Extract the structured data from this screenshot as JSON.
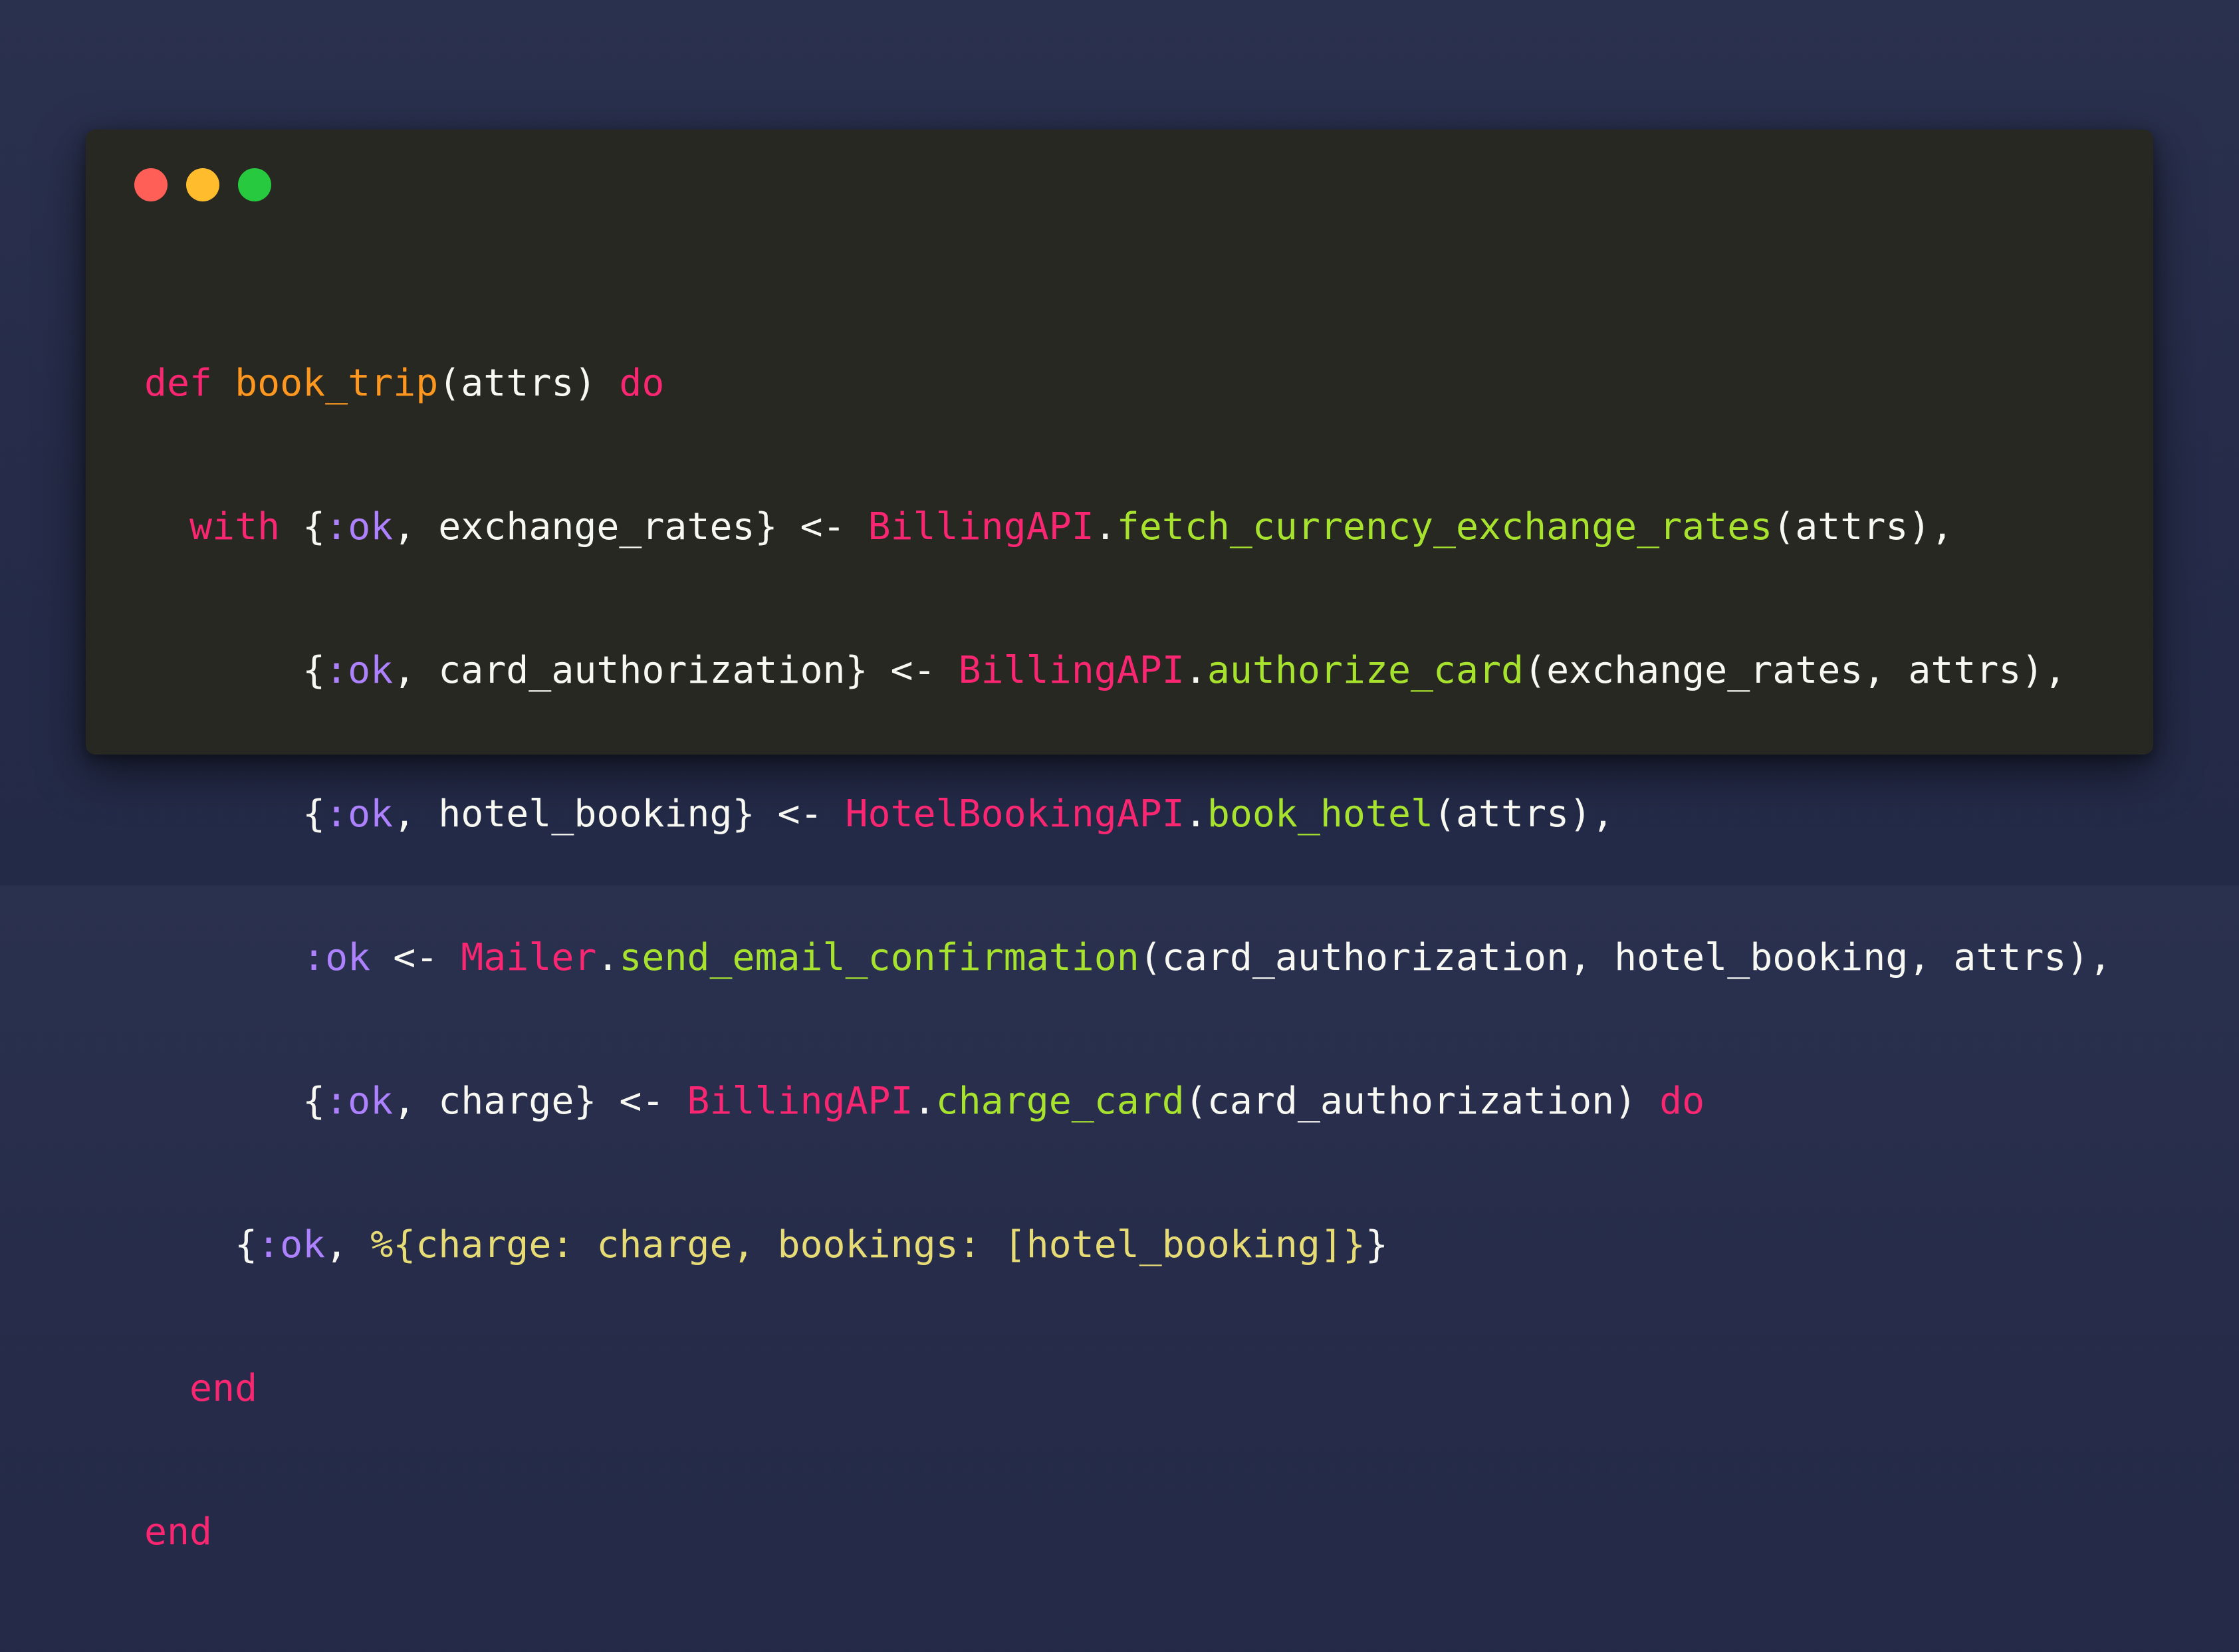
{
  "window": {
    "controls": [
      {
        "name": "close",
        "color": "#ff5f56"
      },
      {
        "name": "minimize",
        "color": "#ffbd2e"
      },
      {
        "name": "maximize",
        "color": "#27c93f"
      }
    ],
    "background_color": "#272822"
  },
  "colors": {
    "keyword": "#f92672",
    "function_name": "#fd971f",
    "atom": "#ae81ff",
    "module": "#f92672",
    "function_call": "#a6e22e",
    "map_literal": "#e6db74",
    "plain": "#f8f8f2",
    "page_background": "#262c4a"
  },
  "code": {
    "lines": [
      [
        {
          "type": "kw",
          "text": "def"
        },
        {
          "type": "plain",
          "text": " "
        },
        {
          "type": "fn",
          "text": "book_trip"
        },
        {
          "type": "plain",
          "text": "(attrs) "
        },
        {
          "type": "kw",
          "text": "do"
        }
      ],
      [
        {
          "type": "plain",
          "text": "  "
        },
        {
          "type": "kw",
          "text": "with"
        },
        {
          "type": "plain",
          "text": " {"
        },
        {
          "type": "atom",
          "text": ":ok"
        },
        {
          "type": "plain",
          "text": ", exchange_rates} <- "
        },
        {
          "type": "mod",
          "text": "BillingAPI"
        },
        {
          "type": "plain",
          "text": "."
        },
        {
          "type": "call",
          "text": "fetch_currency_exchange_rates"
        },
        {
          "type": "plain",
          "text": "(attrs),"
        }
      ],
      [
        {
          "type": "plain",
          "text": "       {"
        },
        {
          "type": "atom",
          "text": ":ok"
        },
        {
          "type": "plain",
          "text": ", card_authorization} <- "
        },
        {
          "type": "mod",
          "text": "BillingAPI"
        },
        {
          "type": "plain",
          "text": "."
        },
        {
          "type": "call",
          "text": "authorize_card"
        },
        {
          "type": "plain",
          "text": "(exchange_rates, attrs),"
        }
      ],
      [
        {
          "type": "plain",
          "text": "       {"
        },
        {
          "type": "atom",
          "text": ":ok"
        },
        {
          "type": "plain",
          "text": ", hotel_booking} <- "
        },
        {
          "type": "mod",
          "text": "HotelBookingAPI"
        },
        {
          "type": "plain",
          "text": "."
        },
        {
          "type": "call",
          "text": "book_hotel"
        },
        {
          "type": "plain",
          "text": "(attrs),"
        }
      ],
      [
        {
          "type": "plain",
          "text": "       "
        },
        {
          "type": "atom",
          "text": ":ok"
        },
        {
          "type": "plain",
          "text": " <- "
        },
        {
          "type": "mod",
          "text": "Mailer"
        },
        {
          "type": "plain",
          "text": "."
        },
        {
          "type": "call",
          "text": "send_email_confirmation"
        },
        {
          "type": "plain",
          "text": "(card_authorization, hotel_booking, attrs),"
        }
      ],
      [
        {
          "type": "plain",
          "text": "       {"
        },
        {
          "type": "atom",
          "text": ":ok"
        },
        {
          "type": "plain",
          "text": ", charge} <- "
        },
        {
          "type": "mod",
          "text": "BillingAPI"
        },
        {
          "type": "plain",
          "text": "."
        },
        {
          "type": "call",
          "text": "charge_card"
        },
        {
          "type": "plain",
          "text": "(card_authorization) "
        },
        {
          "type": "kw",
          "text": "do"
        }
      ],
      [
        {
          "type": "plain",
          "text": "    {"
        },
        {
          "type": "atom",
          "text": ":ok"
        },
        {
          "type": "plain",
          "text": ", "
        },
        {
          "type": "map",
          "text": "%{charge: charge, bookings: [hotel_booking]}"
        },
        {
          "type": "plain",
          "text": "}"
        }
      ],
      [
        {
          "type": "plain",
          "text": "  "
        },
        {
          "type": "kw",
          "text": "end"
        }
      ],
      [
        {
          "type": "kw",
          "text": "end"
        }
      ]
    ]
  }
}
